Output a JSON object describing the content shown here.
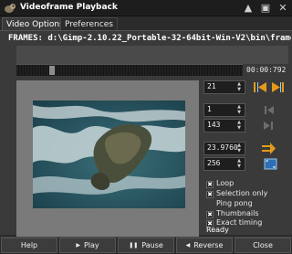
{
  "window": {
    "title": "Videoframe Playback",
    "buttons": {
      "maximize": "▲",
      "restore": "▣",
      "close": "✕"
    }
  },
  "tabs": [
    {
      "label": "Video Options",
      "active": true
    },
    {
      "label": "Preferences",
      "active": false
    }
  ],
  "frames_label": "FRAMES: d:\\Gimp-2.10.22_Portable-32-64bit-Win-V2\\bin\\frame_",
  "timeline": {
    "timecode": "00:00:792"
  },
  "controls": {
    "frame_a": "21",
    "from": "1",
    "to": "143",
    "fps": "23.9760",
    "size": "256"
  },
  "options": [
    {
      "label": "Loop",
      "checked": true
    },
    {
      "label": "Selection only",
      "checked": true
    },
    {
      "label": "Ping pong",
      "checked": false
    },
    {
      "label": "Thumbnails",
      "checked": true
    },
    {
      "label": "Exact timing",
      "checked": true
    }
  ],
  "status": "Ready",
  "bottom_buttons": {
    "help": "Help",
    "play": "Play",
    "pause": "Pause",
    "reverse": "Reverse",
    "close": "Close"
  },
  "colors": {
    "accent": "#e39a1c",
    "panel": "#3a3a3a",
    "preview_sea": "#1e4d5a"
  }
}
